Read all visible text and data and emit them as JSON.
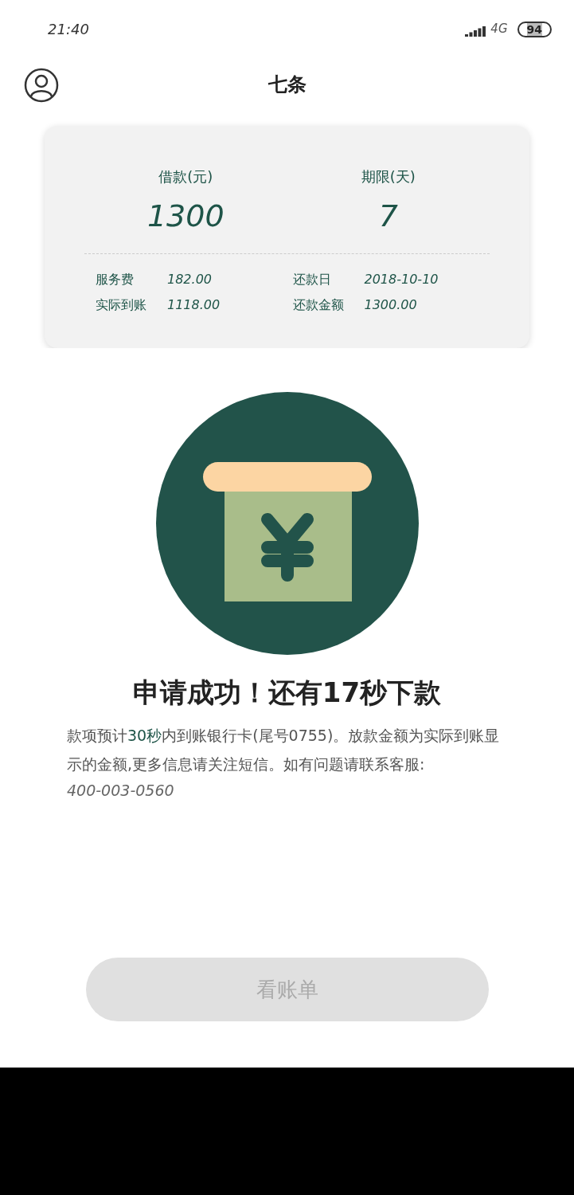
{
  "status_bar": {
    "time": "21:40",
    "network": "4G",
    "battery": "94"
  },
  "header": {
    "title": "七条"
  },
  "loan_card": {
    "summary": [
      {
        "label": "借款(元)",
        "value": "1300"
      },
      {
        "label": "期限(天)",
        "value": "7"
      }
    ],
    "details": [
      {
        "label": "服务费",
        "value": "182.00"
      },
      {
        "label": "还款日",
        "value": "2018-10-10"
      },
      {
        "label": "实际到账",
        "value": "1118.00"
      },
      {
        "label": "还款金额",
        "value": "1300.00"
      }
    ]
  },
  "result": {
    "title": "申请成功！还有17秒下款",
    "message": [
      {
        "text": "款项预计",
        "highlight": false
      },
      {
        "text": "30秒",
        "highlight": true
      },
      {
        "text": "内到账银行卡(尾号0755)。放款金额为实际到账显示的金额,更多信息请关注短信。如有问题请联系客服:",
        "highlight": false
      }
    ],
    "phone": "400-003-0560",
    "button": {
      "label": "看账单",
      "disabled": true
    }
  }
}
